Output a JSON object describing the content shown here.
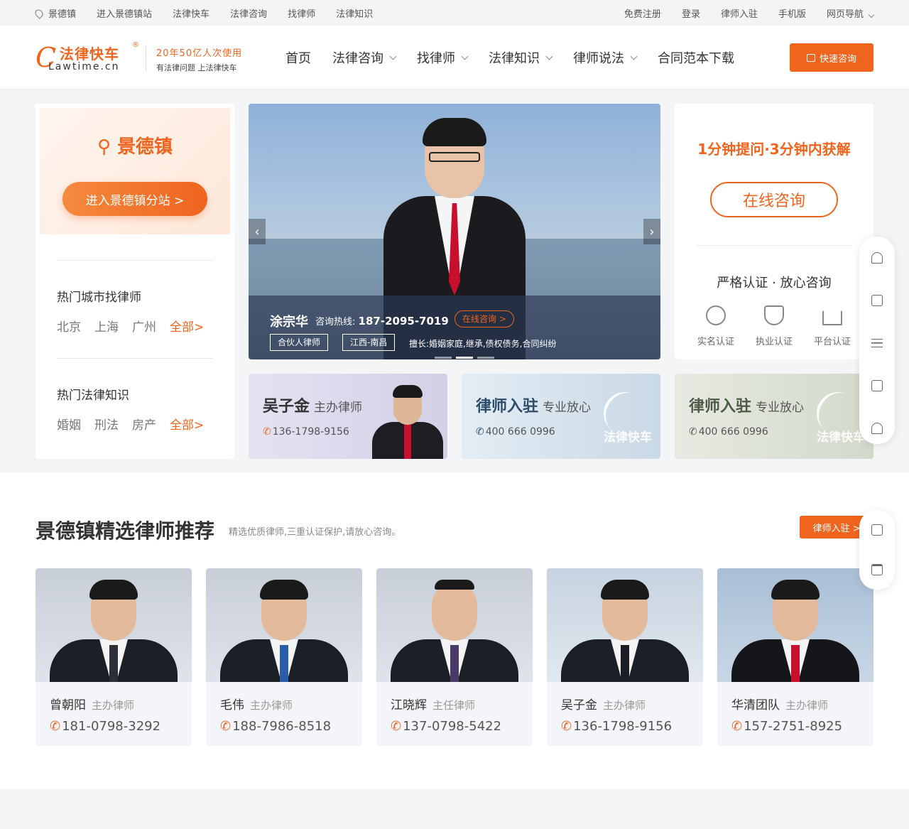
{
  "topbar": {
    "city": "景德镇",
    "left_links": [
      "进入景德镇站",
      "法律快车",
      "法律咨询",
      "找律师",
      "法律知识"
    ],
    "right_links": [
      "免费注册",
      "登录",
      "律师入驻",
      "手机版",
      "网页导航"
    ]
  },
  "header": {
    "logo_cn": "法律快车",
    "logo_en": "Lawtime.cn",
    "logo_reg": "®",
    "slogan_1": "20年50亿人次使用",
    "slogan_2": "有法律问题 上法律快车",
    "nav": [
      "首页",
      "法律咨询",
      "找律师",
      "法律知识",
      "律师说法",
      "合同范本下载"
    ],
    "quick_btn": "快速咨询"
  },
  "city_card": {
    "city": "景德镇",
    "enter_btn": "进入景德镇分站 >",
    "hot_city_title": "热门城市找律师",
    "hot_cities": [
      "北京",
      "上海",
      "广州"
    ],
    "hot_city_more": "全部>",
    "hot_law_title": "热门法律知识",
    "hot_laws": [
      "婚姻",
      "刑法",
      "房产"
    ],
    "hot_law_more": "全部>"
  },
  "banner": {
    "name": "涂宗华",
    "hotline_label": "咨询热线:",
    "hotline": "187-2095-7019",
    "consult_btn": "在线咨询 >",
    "tags": [
      "合伙人律师",
      "江西-南昌"
    ],
    "specialty": "擅长:婚姻家庭,继承,债权债务,合同纠纷"
  },
  "consult_card": {
    "headline": "1分钟提问·3分钟内获解",
    "btn": "在线咨询",
    "title2": "严格认证 · 放心咨询",
    "certs": [
      "实名认证",
      "执业认证",
      "平台认证"
    ]
  },
  "promos": [
    {
      "name": "吴子金",
      "role": "主办律师",
      "phone": "136-1798-9156"
    },
    {
      "name": "律师入驻",
      "role": "专业放心",
      "phone": "400 666 0996",
      "brand": "法律快车"
    },
    {
      "name": "律师入驻",
      "role": "专业放心",
      "phone": "400 666 0996",
      "brand": "法律快车"
    }
  ],
  "section": {
    "title": "景德镇精选律师推荐",
    "subtitle": "精选优质律师,三重认证保护,请放心咨询。",
    "join_btn": "律师入驻 >"
  },
  "lawyers": [
    {
      "name": "曾朝阳",
      "role": "主办律师",
      "phone": "181-0798-3292"
    },
    {
      "name": "毛伟",
      "role": "主办律师",
      "phone": "188-7986-8518"
    },
    {
      "name": "江晓辉",
      "role": "主任律师",
      "phone": "137-0798-5422"
    },
    {
      "name": "吴子金",
      "role": "主办律师",
      "phone": "136-1798-9156"
    },
    {
      "name": "华清团队",
      "role": "主办律师",
      "phone": "157-2751-8925"
    }
  ],
  "colors": {
    "accent": "#f0641e"
  }
}
